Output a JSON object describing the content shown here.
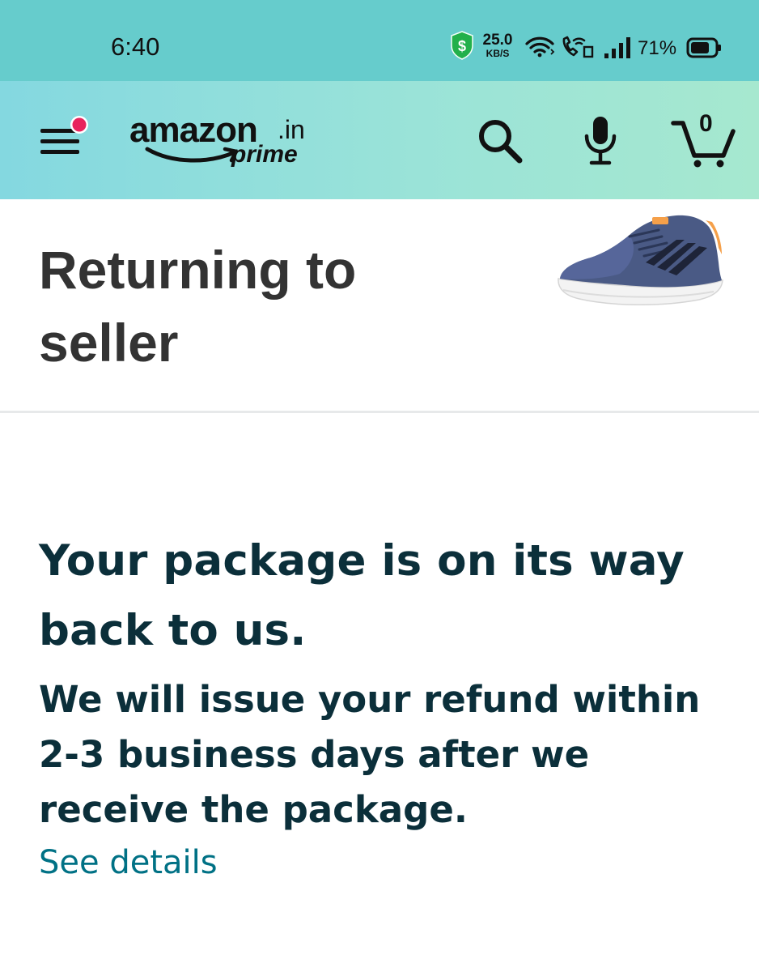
{
  "status_bar": {
    "time": "6:40",
    "net_speed_value": "25.0",
    "net_speed_unit": "KB/S",
    "battery_percent": "71%",
    "icons": [
      "dollar-shield-icon",
      "wifi-icon",
      "volte-call-icon",
      "signal-icon",
      "battery-icon"
    ]
  },
  "header": {
    "logo_main": "amazon",
    "logo_domain": ".in",
    "logo_sub": "prime",
    "cart_count": "0",
    "icons": [
      "menu-icon",
      "notification-dot",
      "search-icon",
      "mic-icon",
      "cart-icon"
    ]
  },
  "order_status": {
    "title": "Returning to seller",
    "product_image": "shoe-image"
  },
  "message": {
    "heading": "Your package is on its way back to us.",
    "body": "We will issue your refund within 2-3 business days after we receive the package.",
    "link": "See details"
  },
  "colors": {
    "status_bar": "#66cccc",
    "header_start": "#84d8e0",
    "header_end": "#a6e8cf",
    "notification_dot": "#e8245d",
    "heading_text": "#0b2f3a",
    "link": "#007185"
  }
}
